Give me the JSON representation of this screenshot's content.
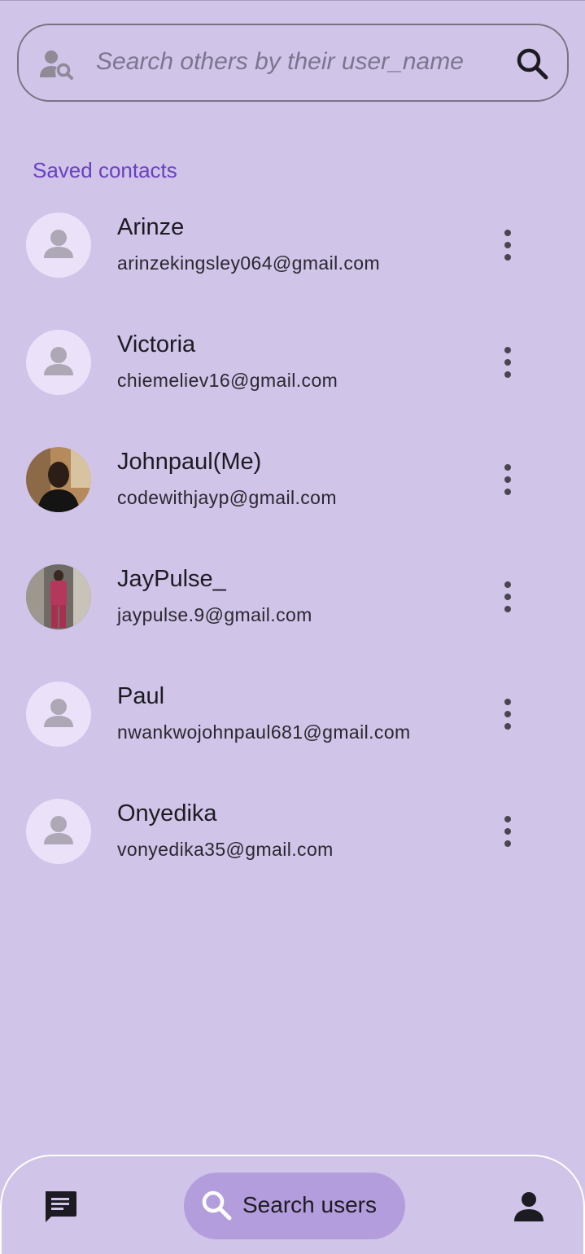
{
  "search": {
    "placeholder": "Search others by their user_name",
    "leading_icon": "person-search-icon",
    "trailing_icon": "search-icon"
  },
  "section_title": "Saved contacts",
  "contacts": [
    {
      "name": "Arinze",
      "email": "arinzekingsley064@gmail.com",
      "avatar": "default-person-icon"
    },
    {
      "name": "Victoria",
      "email": "chiemeliev16@gmail.com",
      "avatar": "default-person-icon"
    },
    {
      "name": "Johnpaul(Me)",
      "email": "codewithjayp@gmail.com",
      "avatar": "photo"
    },
    {
      "name": "JayPulse_",
      "email": "jaypulse.9@gmail.com",
      "avatar": "photo"
    },
    {
      "name": "Paul",
      "email": "nwankwojohnpaul681@gmail.com",
      "avatar": "default-person-icon"
    },
    {
      "name": "Onyedika",
      "email": "vonyedika35@gmail.com",
      "avatar": "default-person-icon"
    }
  ],
  "bottom_nav": {
    "chat_icon": "chat-icon",
    "search_label": "Search users",
    "search_icon": "search-icon",
    "profile_icon": "person-icon"
  },
  "colors": {
    "background": "#d0c4e8",
    "accent": "#6a40bf",
    "nav_active_pill": "#b39ddd",
    "avatar_bg": "#ebe2fa"
  }
}
